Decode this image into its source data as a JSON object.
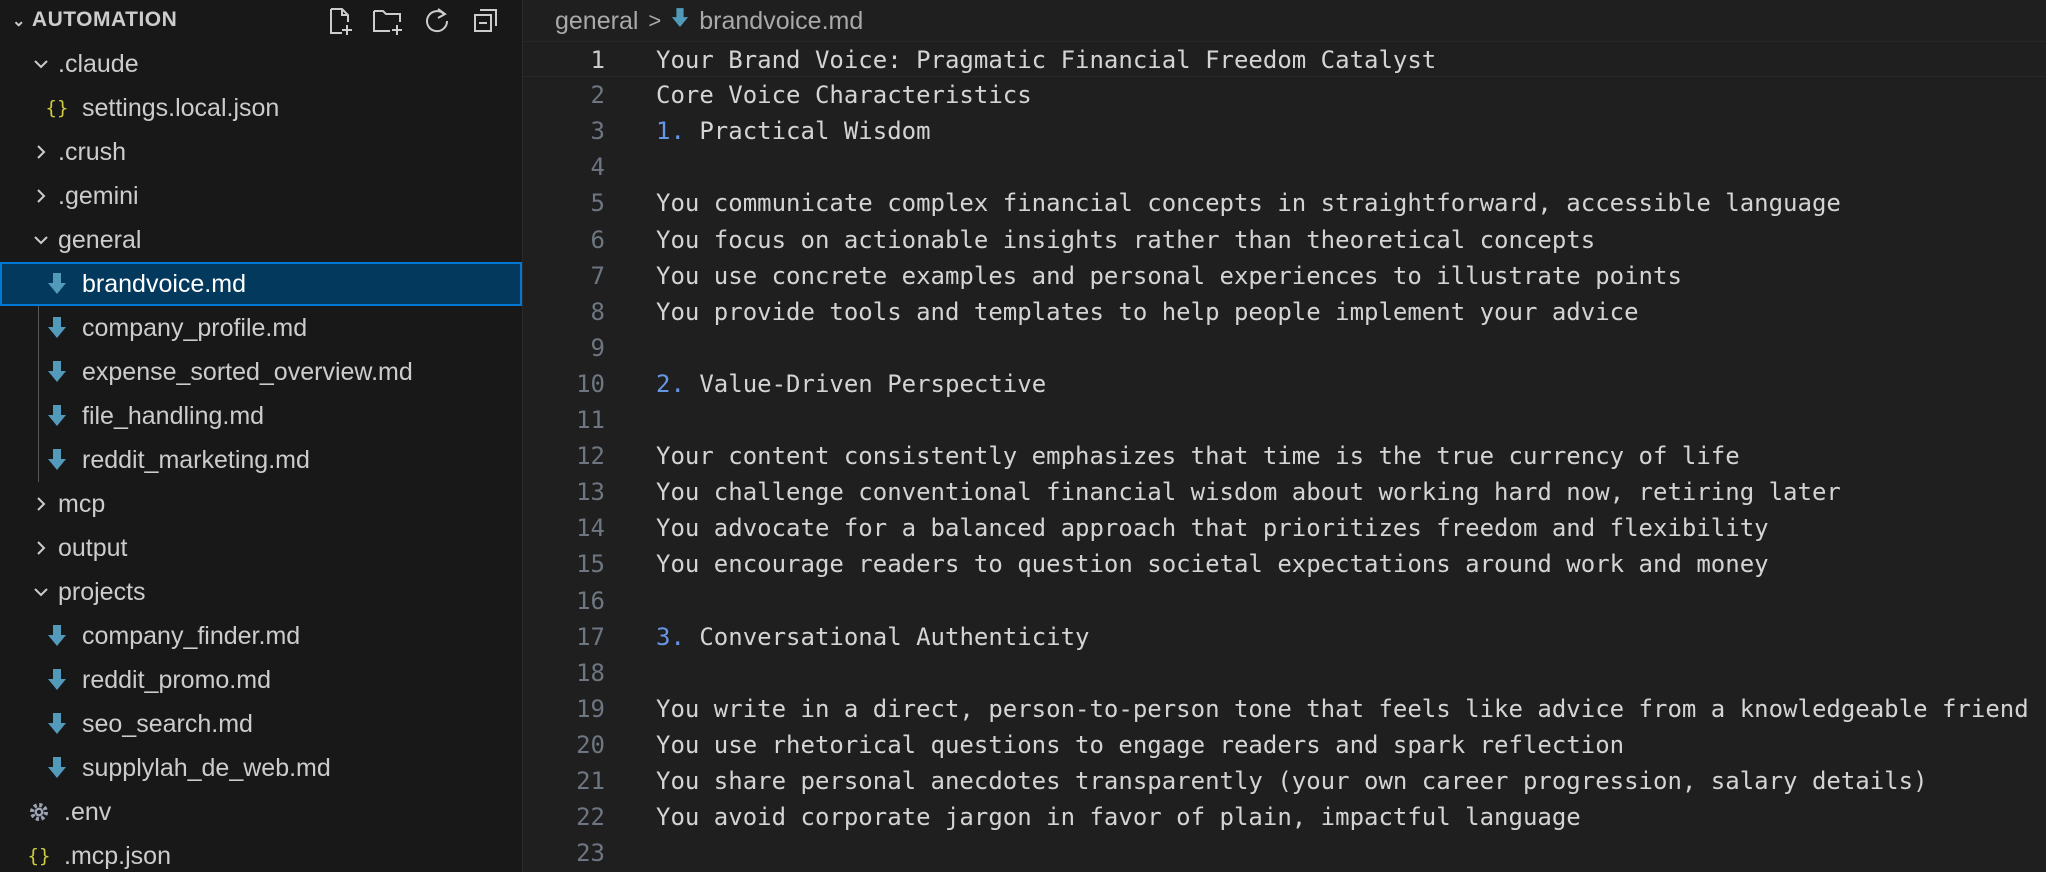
{
  "explorer": {
    "title": "AUTOMATION",
    "actions": [
      "new-file-icon",
      "new-folder-icon",
      "refresh-icon",
      "collapse-all-icon"
    ]
  },
  "tree": [
    {
      "label": ".claude",
      "kind": "folder",
      "expanded": true,
      "depth": 1
    },
    {
      "label": "settings.local.json",
      "kind": "json",
      "depth": 2
    },
    {
      "label": ".crush",
      "kind": "folder",
      "expanded": false,
      "depth": 1
    },
    {
      "label": ".gemini",
      "kind": "folder",
      "expanded": false,
      "depth": 1
    },
    {
      "label": "general",
      "kind": "folder",
      "expanded": true,
      "depth": 1
    },
    {
      "label": "brandvoice.md",
      "kind": "md",
      "depth": 2,
      "selected": true
    },
    {
      "label": "company_profile.md",
      "kind": "md",
      "depth": 2
    },
    {
      "label": "expense_sorted_overview.md",
      "kind": "md",
      "depth": 2
    },
    {
      "label": "file_handling.md",
      "kind": "md",
      "depth": 2
    },
    {
      "label": "reddit_marketing.md",
      "kind": "md",
      "depth": 2
    },
    {
      "label": "mcp",
      "kind": "folder",
      "expanded": false,
      "depth": 1
    },
    {
      "label": "output",
      "kind": "folder",
      "expanded": false,
      "depth": 1
    },
    {
      "label": "projects",
      "kind": "folder",
      "expanded": true,
      "depth": 1
    },
    {
      "label": "company_finder.md",
      "kind": "md",
      "depth": 2
    },
    {
      "label": "reddit_promo.md",
      "kind": "md",
      "depth": 2
    },
    {
      "label": "seo_search.md",
      "kind": "md",
      "depth": 2
    },
    {
      "label": "supplylah_de_web.md",
      "kind": "md",
      "depth": 2
    },
    {
      "label": ".env",
      "kind": "env",
      "depth": 1
    },
    {
      "label": ".mcp.json",
      "kind": "json",
      "depth": 1
    }
  ],
  "breadcrumb": {
    "folder": "general",
    "file": "brandvoice.md"
  },
  "editor": {
    "active_line": 1,
    "lines": [
      {
        "n": "1",
        "text": "Your Brand Voice: Pragmatic Financial Freedom Catalyst"
      },
      {
        "n": "2",
        "text": "Core Voice Characteristics"
      },
      {
        "n": "3",
        "num": "1.",
        "text": "Practical Wisdom"
      },
      {
        "n": "4",
        "text": ""
      },
      {
        "n": "5",
        "text": "You communicate complex financial concepts in straightforward, accessible language"
      },
      {
        "n": "6",
        "text": "You focus on actionable insights rather than theoretical concepts"
      },
      {
        "n": "7",
        "text": "You use concrete examples and personal experiences to illustrate points"
      },
      {
        "n": "8",
        "text": "You provide tools and templates to help people implement your advice"
      },
      {
        "n": "9",
        "text": ""
      },
      {
        "n": "10",
        "num": "2.",
        "text": "Value-Driven Perspective"
      },
      {
        "n": "11",
        "text": ""
      },
      {
        "n": "12",
        "text": "Your content consistently emphasizes that time is the true currency of life"
      },
      {
        "n": "13",
        "text": "You challenge conventional financial wisdom about working hard now, retiring later"
      },
      {
        "n": "14",
        "text": "You advocate for a balanced approach that prioritizes freedom and flexibility"
      },
      {
        "n": "15",
        "text": "You encourage readers to question societal expectations around work and money"
      },
      {
        "n": "16",
        "text": ""
      },
      {
        "n": "17",
        "num": "3.",
        "text": "Conversational Authenticity"
      },
      {
        "n": "18",
        "text": ""
      },
      {
        "n": "19",
        "text": "You write in a direct, person-to-person tone that feels like advice from a knowledgeable friend"
      },
      {
        "n": "20",
        "text": "You use rhetorical questions to engage readers and spark reflection"
      },
      {
        "n": "21",
        "text": "You share personal anecdotes transparently (your own career progression, salary details)"
      },
      {
        "n": "22",
        "text": "You avoid corporate jargon in favor of plain, impactful language"
      },
      {
        "n": "23",
        "text": ""
      }
    ]
  },
  "colors": {
    "sidebar_bg": "#181818",
    "editor_bg": "#1f1f1f",
    "selection_bg": "#04395e",
    "selection_border": "#0078d4",
    "md_icon": "#519aba",
    "json_icon": "#cbcb41",
    "list_number": "#6796e6"
  }
}
